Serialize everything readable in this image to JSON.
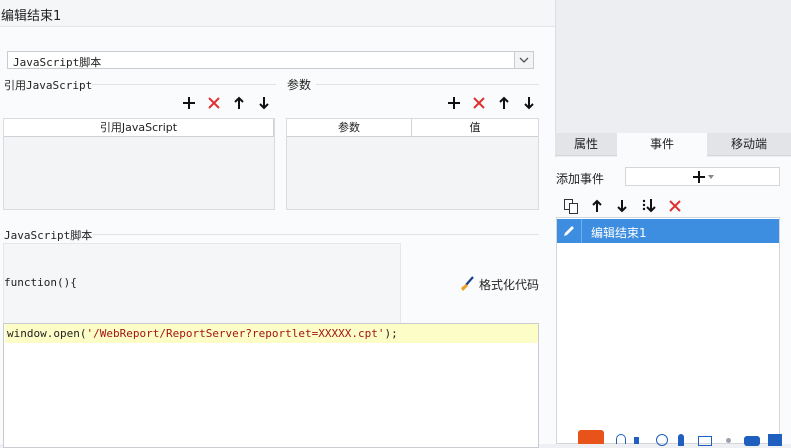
{
  "dialog": {
    "title": "编辑结束1",
    "type_select": {
      "value": "JavaScript脚本"
    },
    "referenced_js": {
      "label": "引用JavaScript",
      "column": "引用JavaScript"
    },
    "params": {
      "label": "参数",
      "columns": [
        "参数",
        "值"
      ]
    },
    "script": {
      "label": "JavaScript脚本",
      "function_header": "function(){",
      "format_label": "格式化代码",
      "code_prefix": "window.open(",
      "code_string": "'/WebReport/ReportServer?reportlet=XXXXX.cpt'",
      "code_suffix": ");"
    }
  },
  "right_panel": {
    "tabs": [
      {
        "label": "属性",
        "active": false
      },
      {
        "label": "事件",
        "active": true
      },
      {
        "label": "移动端",
        "active": false
      }
    ],
    "add_event_label": "添加事件",
    "events": [
      {
        "label": "编辑结束1",
        "selected": true
      }
    ]
  },
  "colors": {
    "delete_red": "#e03131",
    "selection_blue": "#3d8de0",
    "code_highlight": "#fdfdc8",
    "string_color": "#a31515"
  },
  "icons": [
    "plus-icon",
    "delete-icon",
    "arrow-up-icon",
    "arrow-down-icon",
    "copy-icon",
    "move-bottom-icon",
    "edit-icon",
    "brush-icon"
  ]
}
